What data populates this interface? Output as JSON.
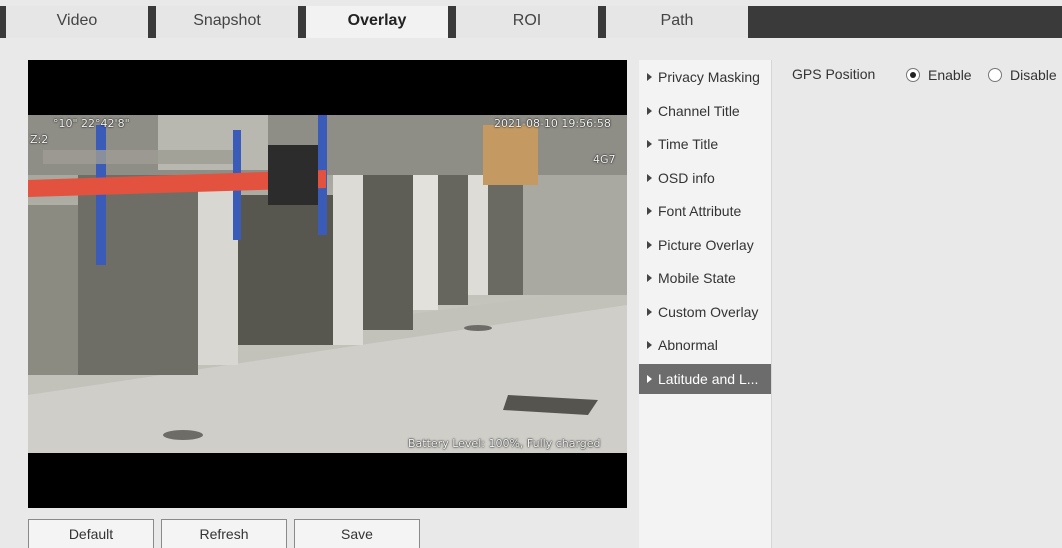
{
  "tabs": [
    {
      "label": "Video",
      "active": false
    },
    {
      "label": "Snapshot",
      "active": false
    },
    {
      "label": "Overlay",
      "active": true
    },
    {
      "label": "ROI",
      "active": false
    },
    {
      "label": "Path",
      "active": false
    }
  ],
  "video": {
    "osd_coords": "°10\" 22°42'8\"",
    "osd_zone": "Z:2",
    "osd_datetime": "2021-08-10 19:56:58",
    "osd_network": "4G7",
    "osd_battery": "Battery Level: 100%, Fully charged"
  },
  "menu": {
    "items": [
      {
        "label": "Privacy Masking",
        "active": false
      },
      {
        "label": "Channel Title",
        "active": false
      },
      {
        "label": "Time Title",
        "active": false
      },
      {
        "label": "OSD info",
        "active": false
      },
      {
        "label": "Font Attribute",
        "active": false
      },
      {
        "label": "Picture Overlay",
        "active": false
      },
      {
        "label": "Mobile State",
        "active": false
      },
      {
        "label": "Custom Overlay",
        "active": false
      },
      {
        "label": "Abnormal",
        "active": false
      },
      {
        "label": "Latitude and L...",
        "active": true
      }
    ]
  },
  "gps": {
    "label": "GPS Position",
    "enable_label": "Enable",
    "disable_label": "Disable",
    "selected": "Enable"
  },
  "buttons": {
    "default_label": "Default",
    "refresh_label": "Refresh",
    "save_label": "Save"
  },
  "colors": {
    "tab_bar": "#3a3a3a",
    "menu_active": "#6c6c6c",
    "background": "#e9e9e9"
  }
}
